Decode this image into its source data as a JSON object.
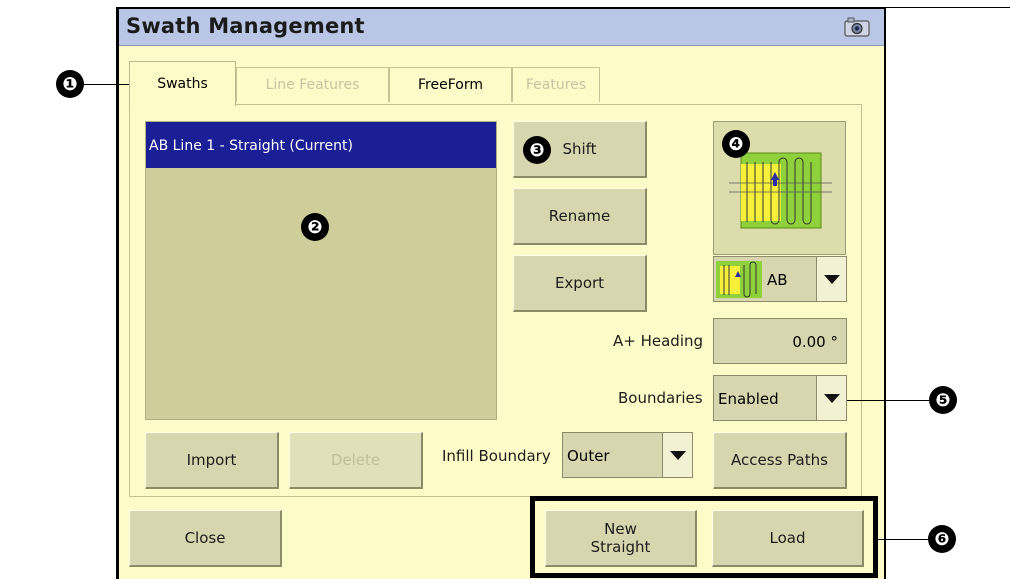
{
  "window": {
    "title": "Swath Management"
  },
  "tabs": [
    {
      "label": "Swaths"
    },
    {
      "label": "Line Features"
    },
    {
      "label": "FreeForm"
    },
    {
      "label": "Features"
    }
  ],
  "swath_list": {
    "items": [
      {
        "label": "AB Line 1 - Straight (Current)"
      }
    ]
  },
  "buttons": {
    "shift": "Shift",
    "rename": "Rename",
    "export": "Export",
    "import": "Import",
    "delete": "Delete",
    "access_paths": "Access Paths",
    "close": "Close",
    "new_straight": "New\nStraight",
    "load": "Load"
  },
  "pattern_select": {
    "value": "AB"
  },
  "heading": {
    "label": "A+ Heading",
    "value": "0.00 °"
  },
  "boundaries": {
    "label": "Boundaries",
    "value": "Enabled"
  },
  "infill_boundary": {
    "label": "Infill Boundary",
    "value": "Outer"
  },
  "callouts": [
    "❶",
    "❷",
    "❸",
    "❹",
    "❺",
    "❻"
  ],
  "colors": {
    "selection": "#1a1f96",
    "titlebar": "#b9c6e6",
    "window_bg": "#fdfcc9",
    "button": "#d8d6ae",
    "pattern_green": "#8fd13a",
    "pattern_yellow": "#f6f03a"
  },
  "icons": {
    "camera": "camera-icon",
    "dropdown": "chevron-down-icon"
  }
}
